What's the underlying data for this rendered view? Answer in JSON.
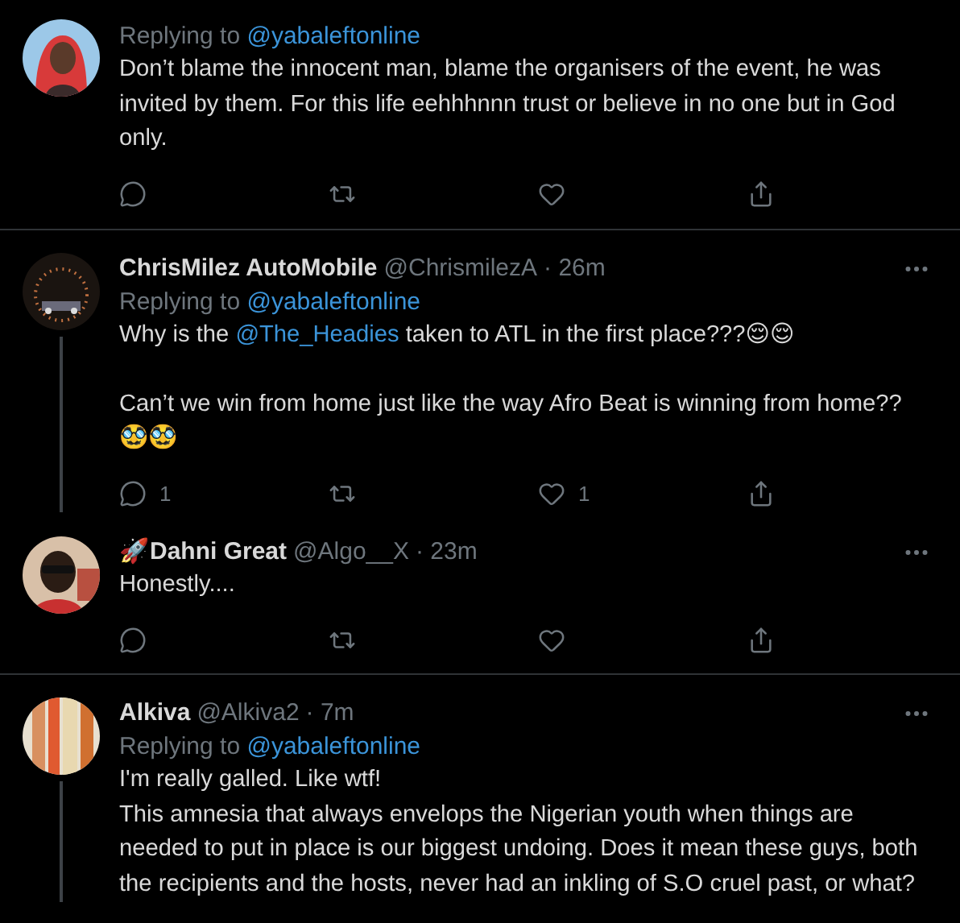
{
  "tweets": [
    {
      "avatar": {
        "kind": "picture"
      },
      "replying_label": "Replying to",
      "replying_to": "@yabaleftonline",
      "body": [
        {
          "kind": "text",
          "text": "Don’t blame the innocent man, blame the organisers of the event, he was invited by them. For this life eehhhnnn trust or believe in no one but in God only."
        }
      ],
      "actions": [
        {
          "kind": "reply"
        },
        {
          "kind": "retweet"
        },
        {
          "kind": "like"
        },
        {
          "kind": "share"
        }
      ],
      "connected_below": false
    },
    {
      "avatar": {
        "kind": "picture"
      },
      "name": "ChrisMilez AutoMobile",
      "handle": "@ChrismilezA",
      "time": "· 26m",
      "more": true,
      "replying_label": "Replying to",
      "replying_to": "@yabaleftonline",
      "body": [
        {
          "kind": "text",
          "text": "Why is the "
        },
        {
          "kind": "mention",
          "text": "@The_Headies"
        },
        {
          "kind": "text",
          "text": " taken to ATL in the first place???😌😌\n\nCan’t we win from home just like the way Afro Beat is winning from home??🥸🥸"
        }
      ],
      "actions": [
        {
          "kind": "reply",
          "count": "1"
        },
        {
          "kind": "retweet"
        },
        {
          "kind": "like",
          "count": "1"
        },
        {
          "kind": "share"
        }
      ],
      "connected_below": true
    },
    {
      "avatar": {
        "kind": "picture"
      },
      "name": "🚀Dahni Great",
      "handle": "@Algo__X",
      "time": "· 23m",
      "more": true,
      "body": [
        {
          "kind": "text",
          "text": "Honestly...."
        }
      ],
      "actions": [
        {
          "kind": "reply"
        },
        {
          "kind": "retweet"
        },
        {
          "kind": "like"
        },
        {
          "kind": "share"
        }
      ],
      "connected_below": false
    },
    {
      "avatar": {
        "kind": "picture"
      },
      "name": "Alkiva",
      "handle": "@Alkiva2",
      "time": "· 7m",
      "more": true,
      "replying_label": "Replying to",
      "replying_to": "@yabaleftonline",
      "body": [
        {
          "kind": "text",
          "text": "I'm really galled. Like wtf!\nThis amnesia that always envelops the Nigerian youth when things are needed to put in place is our biggest undoing. Does it mean these guys, both the recipients and the hosts, never had an inkling of S.O cruel past, or what?"
        }
      ],
      "connected_below": true
    }
  ]
}
